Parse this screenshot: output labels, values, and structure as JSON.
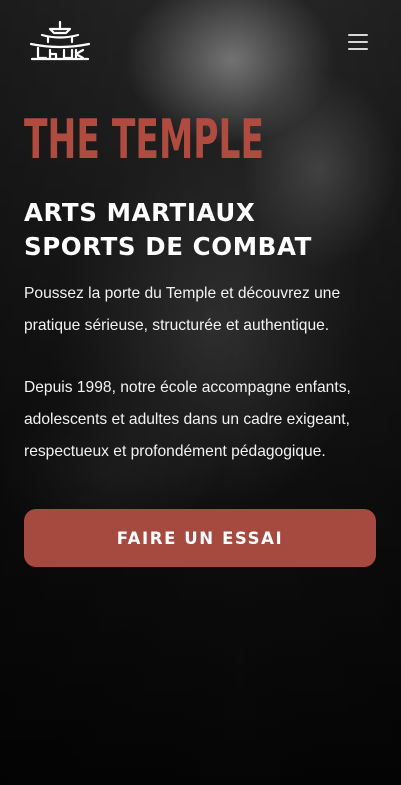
{
  "header": {
    "logo_icon": "pagoda-logo-icon",
    "menu_icon": "hamburger-menu-icon"
  },
  "brand": {
    "name": "THE TEMPLE",
    "color": "#b04b40"
  },
  "hero": {
    "heading": "ARTS MARTIAUX SPORTS DE COMBAT",
    "paragraph_1": "Poussez la porte du Temple et découvrez une pratique sérieuse, structurée et authentique.",
    "paragraph_2": "Depuis 1998, notre école accompagne enfants, adolescents et adultes dans un cadre exigeant, respectueux et profondément pédagogique.",
    "cta_label": "FAIRE UN ESSAI",
    "cta_color": "#a64a40"
  }
}
